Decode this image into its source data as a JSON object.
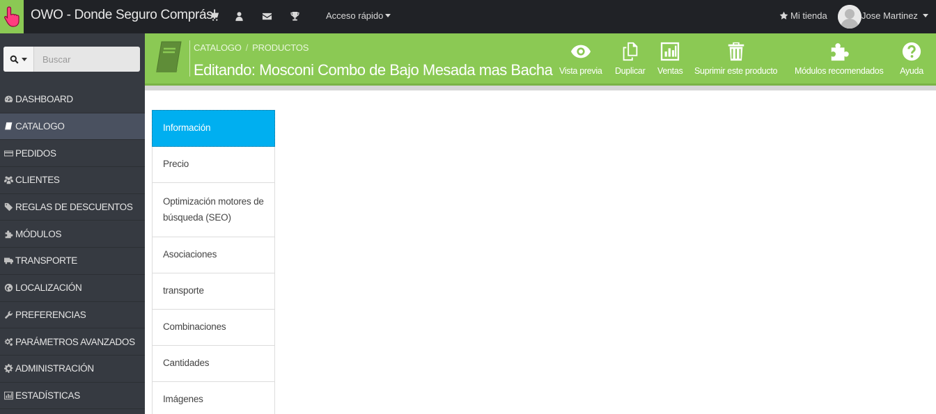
{
  "topbar": {
    "shop_name": "OWO - Donde Seguro Comprás!",
    "icons": [
      "cart-icon",
      "user-icon",
      "envelope-icon",
      "trophy-icon"
    ],
    "quick_access": "Acceso rápido",
    "my_shop": "Mi tienda",
    "user_name": "Jose Martinez"
  },
  "sidebar": {
    "search_placeholder": "Buscar",
    "items": [
      {
        "label": "DASHBOARD",
        "icon": "dashboard-icon"
      },
      {
        "label": "CATALOGO",
        "icon": "book-icon",
        "active": true
      },
      {
        "label": "PEDIDOS",
        "icon": "credit-card-icon"
      },
      {
        "label": "CLIENTES",
        "icon": "users-icon"
      },
      {
        "label": "REGLAS DE DESCUENTOS",
        "icon": "tags-icon"
      },
      {
        "label": "MÓDULOS",
        "icon": "puzzle-icon"
      },
      {
        "label": "TRANSPORTE",
        "icon": "truck-icon"
      },
      {
        "label": "LOCALIZACIÓN",
        "icon": "globe-icon"
      },
      {
        "label": "PREFERENCIAS",
        "icon": "wrench-icon"
      },
      {
        "label": "PARÁMETROS AVANZADOS",
        "icon": "cogs-icon"
      },
      {
        "label": "ADMINISTRACIÓN",
        "icon": "cog-icon"
      },
      {
        "label": "ESTADÍSTICAS",
        "icon": "bar-chart-icon"
      }
    ]
  },
  "header": {
    "breadcrumb": [
      "CATALOGO",
      "PRODUCTOS"
    ],
    "breadcrumb_separator": "/",
    "title": "Editando: Mosconi Combo de Bajo Mesada mas Bacha con",
    "toolbar": [
      {
        "label": "Vista previa",
        "icon": "eye-icon"
      },
      {
        "label": "Duplicar",
        "icon": "copy-icon"
      },
      {
        "label": "Ventas",
        "icon": "bar-chart-icon"
      },
      {
        "label": "Suprimir este producto",
        "icon": "trash-icon"
      },
      {
        "label": "Módulos recomendados",
        "icon": "puzzle-icon"
      },
      {
        "label": "Ayuda",
        "icon": "help-icon"
      }
    ]
  },
  "tabs": [
    {
      "label": "Información",
      "active": true
    },
    {
      "label": "Precio"
    },
    {
      "label": "Optimización motores de búsqueda (SEO)"
    },
    {
      "label": "Asociaciones"
    },
    {
      "label": "transporte"
    },
    {
      "label": "Combinaciones"
    },
    {
      "label": "Cantidades"
    },
    {
      "label": "Imágenes"
    }
  ],
  "colors": {
    "topbar_bg": "#202226",
    "sidebar_bg": "#363a41",
    "brand_green": "#8bc954",
    "active_tab": "#00aff0"
  }
}
